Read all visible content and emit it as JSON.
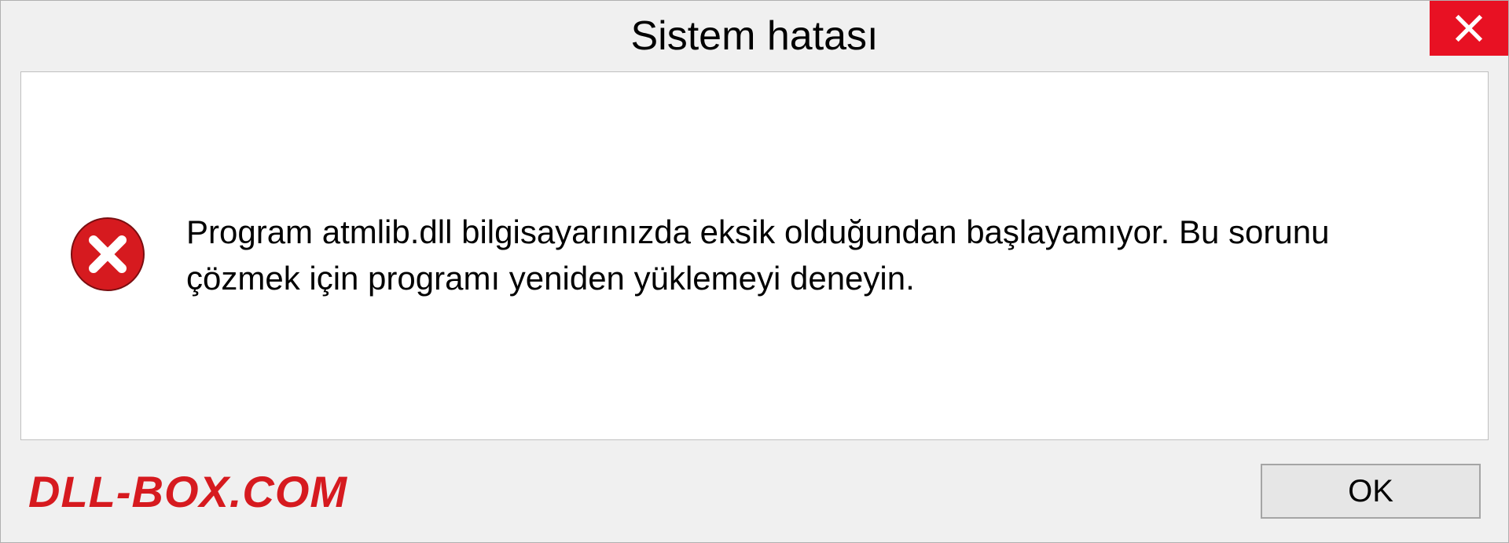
{
  "dialog": {
    "title": "Sistem hatası",
    "message": "Program atmlib.dll bilgisayarınızda eksik olduğundan başlayamıyor. Bu sorunu çözmek için programı yeniden yüklemeyi deneyin.",
    "ok_label": "OK"
  },
  "watermark": "DLL-BOX.COM",
  "colors": {
    "close_bg": "#e81123",
    "error_icon": "#d61a1f",
    "watermark": "#d61a1f"
  }
}
